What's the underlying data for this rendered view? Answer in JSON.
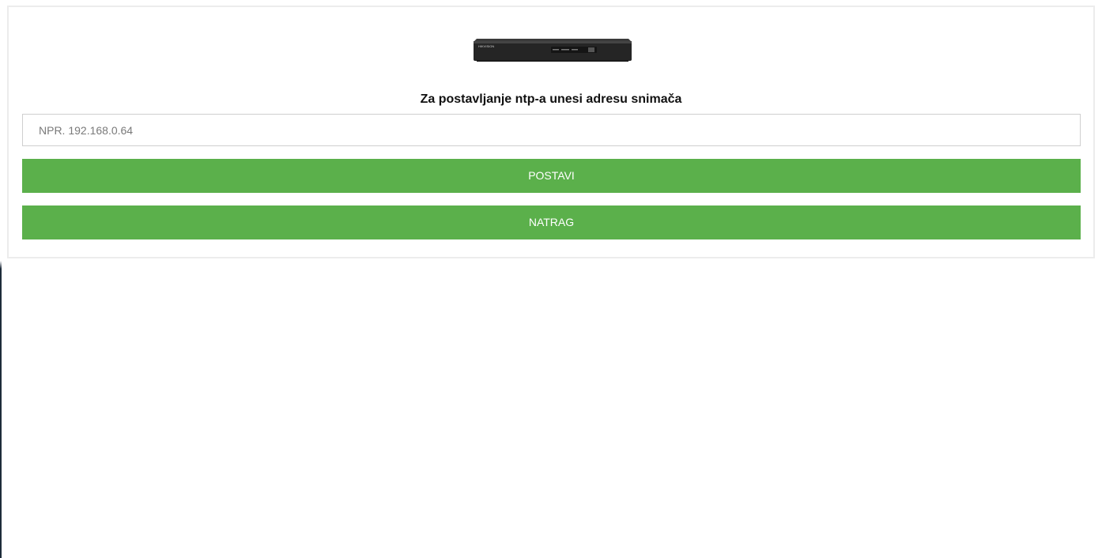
{
  "form": {
    "device_image": "dvr-recorder-image",
    "device_brand_text": "HIKVISION",
    "heading": "Za postavljanje ntp-a unesi adresu snimača",
    "address_input": {
      "value": "",
      "placeholder": "NPR. 192.168.0.64"
    },
    "set_button_label": "POSTAVI",
    "back_button_label": "NATRAG"
  },
  "colors": {
    "button_bg": "#5bb04b",
    "button_text": "#ffffff",
    "card_border": "#ececec",
    "input_border": "#cfcfcf"
  }
}
